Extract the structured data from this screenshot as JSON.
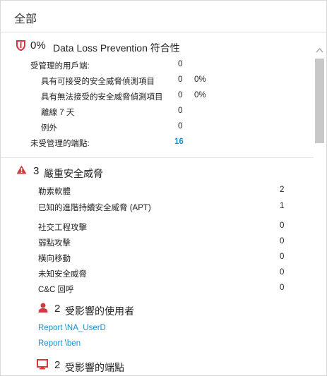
{
  "header": {
    "title": "全部"
  },
  "dlp": {
    "percent": "0%",
    "title": "Data Loss Prevention 符合性",
    "managed_label": "受管理的用戶端:",
    "managed_value": "0",
    "acceptable_label": "具有可接受的安全威脅偵測項目",
    "acceptable_value": "0",
    "acceptable_pct": "0%",
    "unacceptable_label": "具有無法接受的安全威脅偵測項目",
    "unacceptable_value": "0",
    "unacceptable_pct": "0%",
    "offline_label": "離線 7 天",
    "offline_value": "0",
    "exceptions_label": "例外",
    "exceptions_value": "0",
    "unmanaged_label": "未受管理的端點:",
    "unmanaged_value": "16",
    "shield_color": "#d9363e"
  },
  "threats": {
    "count": "3",
    "title": "嚴重安全威脅",
    "alert_color": "#d9363e",
    "items": [
      {
        "label": "勒索軟體",
        "value": "2"
      },
      {
        "label": "已知的進階持續安全威脅 (APT)",
        "value": "1"
      },
      {
        "label": "社交工程攻擊",
        "value": "0"
      },
      {
        "label": "弱點攻擊",
        "value": "0"
      },
      {
        "label": "橫向移動",
        "value": "0"
      },
      {
        "label": "未知安全威脅",
        "value": "0"
      },
      {
        "label": "C&C 回呼",
        "value": "0"
      }
    ]
  },
  "users": {
    "count": "2",
    "title": "受影響的使用者",
    "links": [
      "Report \\NA_UserD",
      "Report \\ben"
    ]
  },
  "endpoints": {
    "count": "2",
    "title": "受影響的端點"
  },
  "colors": {
    "link": "#1a8ec9",
    "accent_red": "#d9363e"
  }
}
